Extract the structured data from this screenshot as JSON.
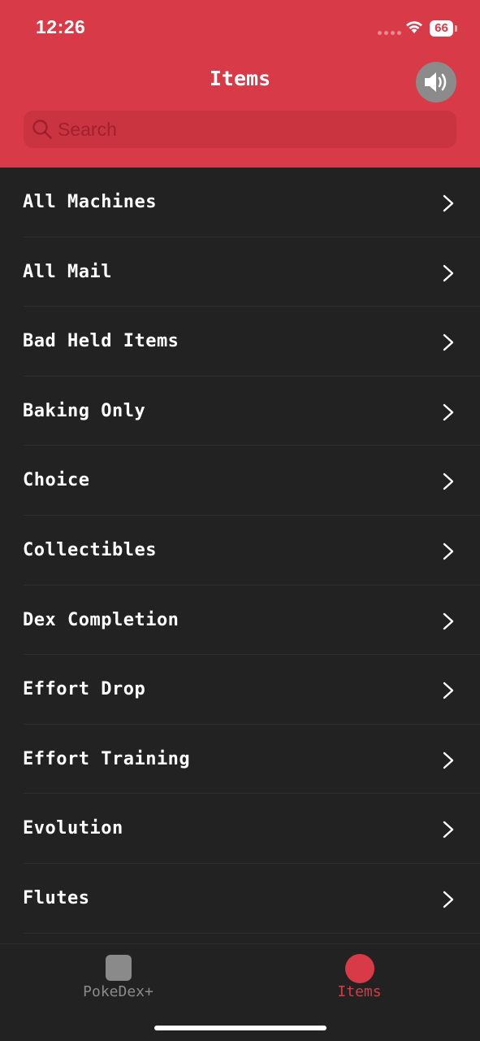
{
  "status_bar": {
    "time": "12:26",
    "battery": "66"
  },
  "header": {
    "title": "Items",
    "sound_icon": "speaker-volume-icon"
  },
  "search": {
    "placeholder": "Search",
    "value": ""
  },
  "list": {
    "items": [
      {
        "label": "All Machines"
      },
      {
        "label": "All Mail"
      },
      {
        "label": "Bad Held Items"
      },
      {
        "label": "Baking Only"
      },
      {
        "label": "Choice"
      },
      {
        "label": "Collectibles"
      },
      {
        "label": "Dex Completion"
      },
      {
        "label": "Effort Drop"
      },
      {
        "label": "Effort Training"
      },
      {
        "label": "Evolution"
      },
      {
        "label": "Flutes"
      }
    ]
  },
  "tab_bar": {
    "tabs": [
      {
        "label": "PokeDex+",
        "active": false
      },
      {
        "label": "Items",
        "active": true
      }
    ]
  },
  "colors": {
    "accent": "#d93a48",
    "background": "#222222",
    "inactive": "#8a8a8a"
  }
}
